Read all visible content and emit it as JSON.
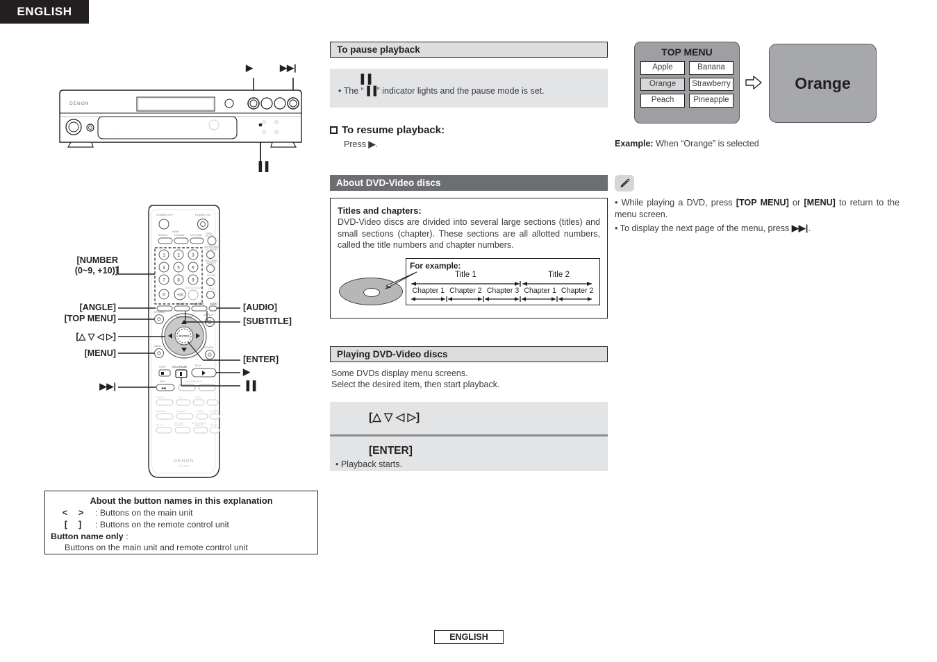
{
  "language_tab": "ENGLISH",
  "footer": "ENGLISH",
  "player_callouts": {
    "play": "▶",
    "skip_forward": "▶▶|",
    "pause": "▐▐"
  },
  "remote": {
    "brand": "DENON",
    "model": "RC-1027",
    "left_callouts": [
      {
        "label": "[NUMBER",
        "label2": "(0~9, +10)]"
      },
      {
        "label": "[ANGLE]"
      },
      {
        "label": "[TOP MENU]"
      },
      {
        "label": "[△ ▽ ◁ ▷]"
      },
      {
        "label": "[MENU]"
      },
      {
        "label": "▶▶|"
      }
    ],
    "right_callouts": [
      {
        "label": "[AUDIO]"
      },
      {
        "label": "[SUBTITLE]"
      },
      {
        "label": "[ENTER]"
      },
      {
        "label": "▶"
      },
      {
        "label": "▐▐"
      }
    ],
    "keypad": [
      "1",
      "2",
      "3",
      "4",
      "5",
      "6",
      "7",
      "8",
      "9",
      "0",
      "+10"
    ],
    "key_labels": {
      "power_off": "POWER OFF",
      "power_on": "POWER ON",
      "select": "SELECT",
      "format": "FORMAT",
      "ntsc_pal": "NTSC/PAL",
      "open_close": "OPEN/CLOSE",
      "super_audio_cd_setup": "SUPER AUDIO CD SETUP",
      "program_direct": "PROGRAM /DIRECT",
      "clear": "CLEAR",
      "call": "CALL",
      "search_mode": "SEARCH MODE",
      "angle": "ANGLE",
      "subtitle": "SUBTITLE",
      "audio": "AUDIO",
      "top_menu": "TOP MENU",
      "display": "DISPLAY",
      "menu": "MENU",
      "return": "RETURN",
      "enter": "ENTER",
      "stop": "STOP",
      "still_pause": "STILL/PAUSE",
      "play": "PLAY",
      "skip": "SKIP",
      "slow_search": "SLOW/SEARCH",
      "repeat": "REPEAT",
      "ab": "A-B",
      "page": "PAGE",
      "random": "RANDOM",
      "marker": "MARKER",
      "zoom": "ZOOM",
      "v_mode": "V.MODE",
      "setup": "SETUP",
      "picture_adjust": "PICTURE ADJUST",
      "auto_direct_memory": "AUTO DIRECT MEMORY",
      "select2": "SELECT"
    }
  },
  "legend": {
    "title": "About the button names in this explanation",
    "rows": [
      {
        "symbol_open": "<",
        "symbol_close": ">",
        "text": ": Buttons on the main unit"
      },
      {
        "symbol_open": "[",
        "symbol_close": "]",
        "text": ": Buttons on the remote control unit"
      }
    ],
    "bold_label": "Button name only",
    "bold_suffix": ":",
    "last_line": "Buttons on the main unit and remote control unit"
  },
  "mid": {
    "pause_header": "To pause playback",
    "pause_symbol": "▐▐",
    "pause_bullet_pre": "• The “",
    "pause_bullet_sym": "▐▐",
    "pause_bullet_post": "” indicator lights and the pause mode is set.",
    "resume_header": "To resume playback:",
    "resume_text_pre": "Press ",
    "resume_text_sym": "▶",
    "resume_text_post": ".",
    "about_header": "About DVD-Video discs",
    "about_title": "Titles and chapters:",
    "about_body": "DVD-Video discs are divided into several large sections (titles) and small sections (chapter). These sections are all allotted numbers, called the title numbers and chapter numbers.",
    "example_label": "For example:",
    "titles": [
      "Title 1",
      "Title 2"
    ],
    "chapters_title1": [
      "Chapter 1",
      "Chapter 2",
      "Chapter 3"
    ],
    "chapters_title2": [
      "Chapter 1",
      "Chapter 2"
    ],
    "playing_header": "Playing DVD-Video discs",
    "playing_line1": "Some DVDs display menu screens.",
    "playing_line2": "Select the desired item, then start playback.",
    "key_cursor": "[△ ▽ ◁ ▷]",
    "key_enter": "[ENTER]",
    "key_enter_sub": "• Playback starts."
  },
  "right": {
    "menu_title": "TOP MENU",
    "menu_items": [
      {
        "label": "Apple",
        "selected": false
      },
      {
        "label": "Banana",
        "selected": false
      },
      {
        "label": "Orange",
        "selected": true
      },
      {
        "label": "Strawberry",
        "selected": false
      },
      {
        "label": "Peach",
        "selected": false
      },
      {
        "label": "Pineapple",
        "selected": false
      }
    ],
    "screen_text": "Orange",
    "caption_bold": "Example:",
    "caption_text": " When “Orange” is selected",
    "notes": [
      {
        "pre": "• While playing a DVD, press ",
        "b1": "[TOP MENU]",
        "mid": " or ",
        "b2": "[MENU]",
        "post": " to return to the menu screen."
      },
      {
        "pre": "• To display the next page of the menu, press ",
        "b1": "▶▶|",
        "mid": "",
        "b2": "",
        "post": "."
      }
    ]
  },
  "colors": {
    "header_light_bg": "#dcdddf",
    "header_dark_bg": "#6d6e71",
    "gray_block_bg": "#e3e4e6",
    "ink": "#231f20",
    "menu_panel": "#9d9fa2",
    "screen_panel": "#a6a8ab"
  }
}
